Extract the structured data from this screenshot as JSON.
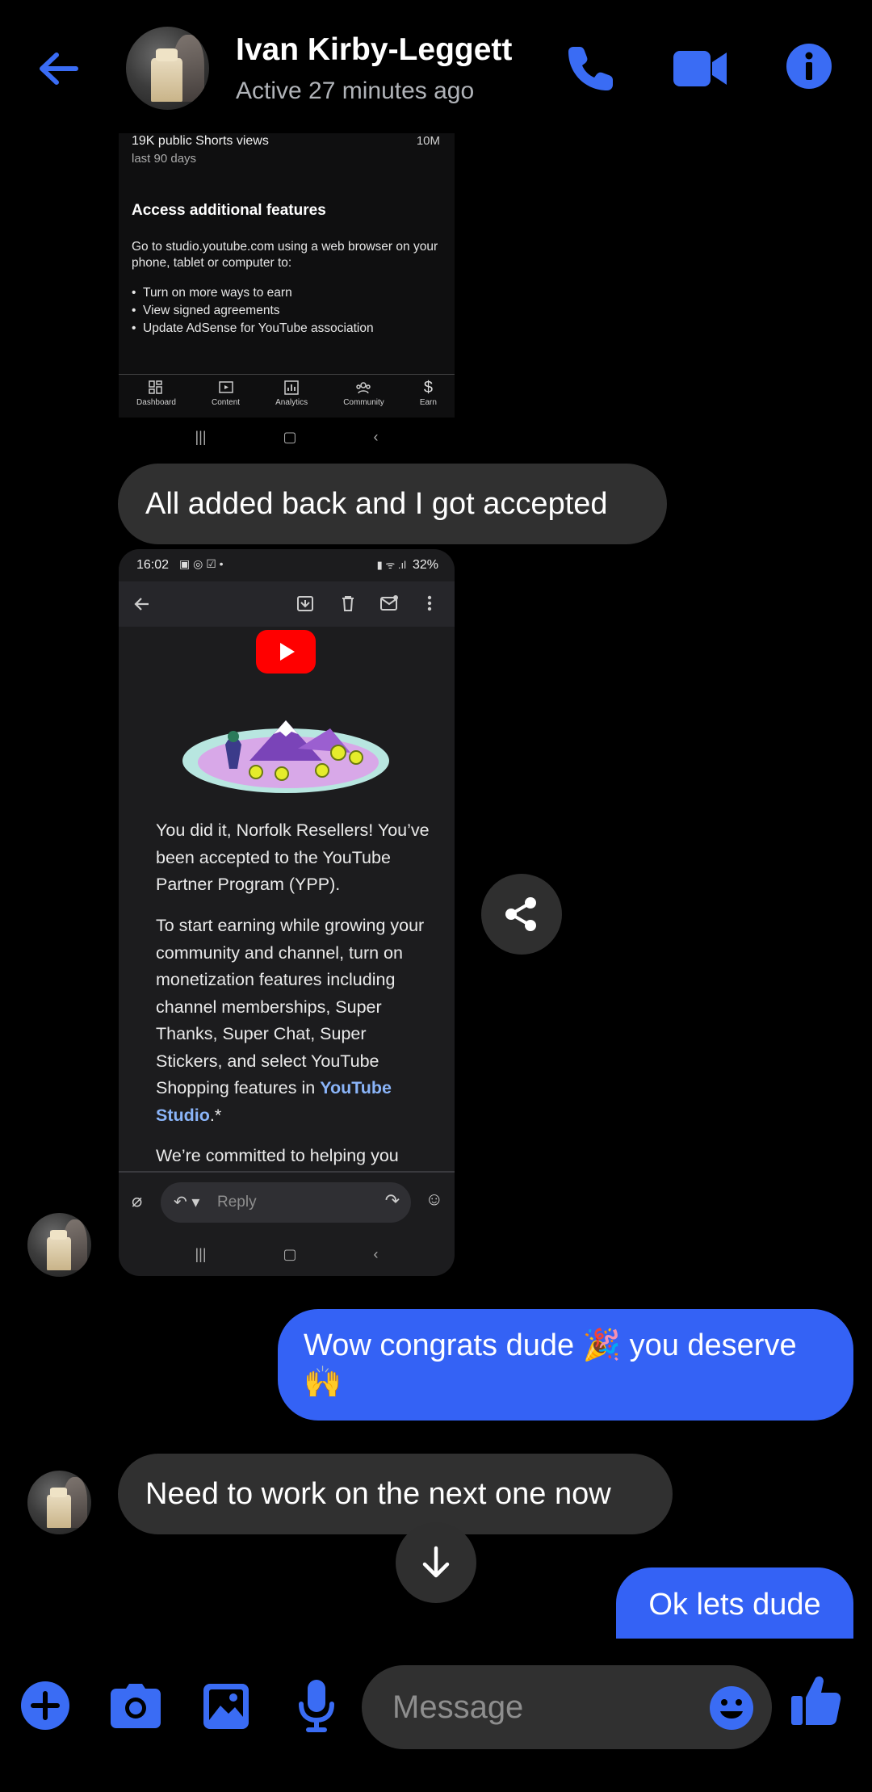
{
  "header": {
    "contact_name": "Ivan Kirby-Leggett",
    "status": "Active 27 minutes ago",
    "icons": [
      "back-arrow-icon",
      "phone-icon",
      "video-camera-icon",
      "info-icon"
    ],
    "accent_color": "#3a6cf4"
  },
  "screenshot1": {
    "views_label": "19K public Shorts views",
    "views_sub": "last 90 days",
    "views_right": "10M",
    "section_title": "Access additional features",
    "description": "Go to studio.youtube.com using a web browser on your phone, tablet or computer to:",
    "bullets": [
      "Turn on more ways to earn",
      "View signed agreements",
      "Update AdSense for YouTube association"
    ],
    "nav": [
      "Dashboard",
      "Content",
      "Analytics",
      "Community",
      "Earn"
    ]
  },
  "messages": {
    "msg1": "All added back and I got accepted",
    "msg3": "Wow congrats dude 🎉 you deserve 🙌",
    "msg4": "Need to work on the next one now",
    "msg5": "Ok lets dude"
  },
  "screenshot2": {
    "time": "16:02",
    "battery": "32%",
    "para1": "You did it, Norfolk Resellers! You’ve been accepted to the YouTube Partner Program (YPP).",
    "para2_text": "To start earning while growing your community and channel, turn on monetization features including channel memberships, Super Thanks, Super Chat, Super Stickers, and select YouTube Shopping features in ",
    "para2_link": "YouTube Studio",
    "para2_end": ".*",
    "para3": "We’re committed to helping you",
    "reply_placeholder": "Reply"
  },
  "composer": {
    "placeholder": "Message",
    "icons": [
      "plus-icon",
      "camera-icon",
      "gallery-icon",
      "microphone-icon",
      "emoji-icon",
      "thumbs-up-icon"
    ]
  }
}
